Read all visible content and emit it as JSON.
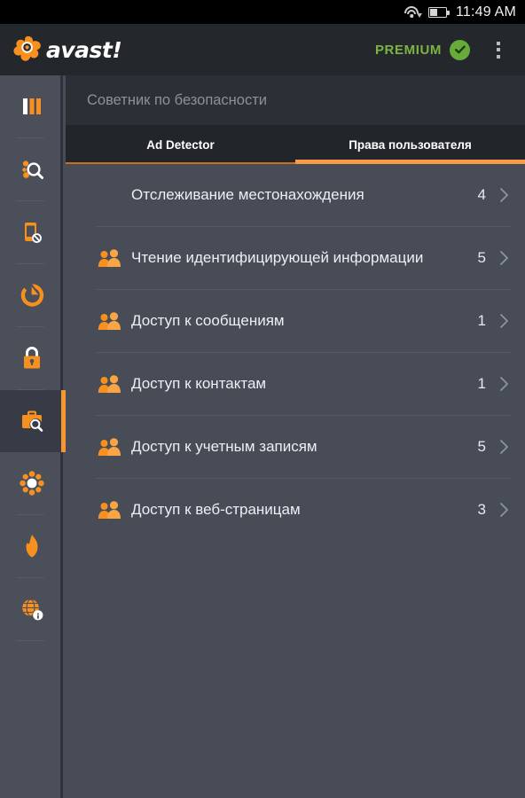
{
  "statusbar": {
    "wifi_icon": "wifi-icon",
    "wifi_arrow_icon": "wifi-download-arrow-icon",
    "battery_icon": "battery-half-icon",
    "time": "11:49 AM"
  },
  "actionbar": {
    "logo_icon": "avast-splat-logo-icon",
    "logo_text": "avast!",
    "premium_label": "PREMIUM",
    "premium_check_icon": "green-check-circle-icon",
    "overflow_icon": "overflow-menu-icon"
  },
  "sidebar": {
    "items": [
      {
        "icon": "dashboard-bars-icon",
        "name": "sidebar-item-dashboard"
      },
      {
        "icon": "virus-scan-magnifier-icon",
        "name": "sidebar-item-scan"
      },
      {
        "icon": "phone-block-icon",
        "name": "sidebar-item-call-blocker"
      },
      {
        "icon": "refresh-circle-icon",
        "name": "sidebar-item-backup"
      },
      {
        "icon": "padlock-icon",
        "name": "sidebar-item-app-lock"
      },
      {
        "icon": "briefcase-magnifier-icon",
        "name": "sidebar-item-app-advisor"
      },
      {
        "icon": "asterisk-burst-icon",
        "name": "sidebar-item-cleanup"
      },
      {
        "icon": "flame-icon",
        "name": "sidebar-item-firewall"
      },
      {
        "icon": "globe-info-icon",
        "name": "sidebar-item-network-meter"
      }
    ],
    "active_index": 5
  },
  "content": {
    "page_title": "Советник по безопасности",
    "tabs": [
      {
        "label": "Ad Detector",
        "active": false
      },
      {
        "label": "Права пользователя",
        "active": true
      }
    ],
    "rows": [
      {
        "icon": "",
        "label": "Отслеживание местонахождения",
        "count": "4",
        "chevron": "chevron-right-icon"
      },
      {
        "icon": "group-people-icon",
        "label": "Чтение идентифицирующей информации",
        "count": "5",
        "chevron": "chevron-right-icon"
      },
      {
        "icon": "group-people-icon",
        "label": "Доступ к сообщениям",
        "count": "1",
        "chevron": "chevron-right-icon"
      },
      {
        "icon": "group-people-icon",
        "label": "Доступ к контактам",
        "count": "1",
        "chevron": "chevron-right-icon"
      },
      {
        "icon": "group-people-icon",
        "label": "Доступ к учетным записям",
        "count": "5",
        "chevron": "chevron-right-icon"
      },
      {
        "icon": "group-people-icon",
        "label": "Доступ к веб-страницам",
        "count": "3",
        "chevron": "chevron-right-icon"
      }
    ]
  },
  "colors": {
    "accent_orange": "#f89632",
    "premium_green": "#7cb342",
    "content_bg": "#474c57",
    "sidebar_bg": "#4a4f5a",
    "actionbar_bg": "#24282d",
    "tabbar_bg": "#22262b"
  }
}
